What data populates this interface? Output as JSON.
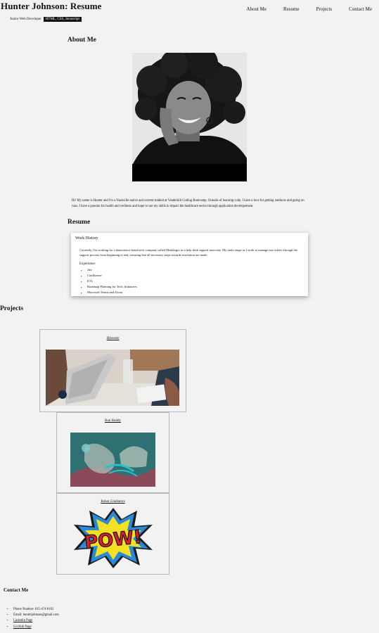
{
  "header": {
    "title": "Hunter Johnson: Resume",
    "role": "Junior Web Developer",
    "skills_tag": "HTML, CSS, Javascript"
  },
  "nav": {
    "items": [
      {
        "label": "About Me"
      },
      {
        "label": "Resume"
      },
      {
        "label": "Projects"
      },
      {
        "label": "Contact Me"
      }
    ]
  },
  "about": {
    "heading": "About Me",
    "bio": "Hi! My name is Hunter and I'm a Nashville native and current student at Vanderbilt Coding Bootcamp. Outside of learning code, I have a love for getting outdoors and going on runs. I have a passion for health and wellness and hope to use my skills to impact the healthcare sector through application developement."
  },
  "resume": {
    "heading": "Resume",
    "work_title": "Work History",
    "work_text": "Currently, I'm working for a datascience based tech company called Medalogix as a help desk support associate. My tasks range as I work to manage osa tickets through the support process from beginning to end, ensuring that all necessary steps towards resolution are made.",
    "experience_label": "Experience",
    "experience_items": [
      {
        "label": "Jira"
      },
      {
        "label": "Confluence"
      },
      {
        "label": "ETL"
      },
      {
        "label": "Roadmap Planning for Tech. Initiatives"
      },
      {
        "label": "Microsoft Teams and Zoom"
      }
    ]
  },
  "projects": {
    "heading": "Projects",
    "items": [
      {
        "title": "Hireseen"
      },
      {
        "title": "Run Buddy"
      },
      {
        "title": "Robot Gladiators"
      }
    ],
    "pow_text": "POW!"
  },
  "contact": {
    "heading": "Contact Me",
    "phone": "Phone Number: 615-474-8162",
    "email": "Email: huntmjohnson@gmail.com",
    "linkedin": "Linkedin Page",
    "github": "Git Hub Page"
  }
}
